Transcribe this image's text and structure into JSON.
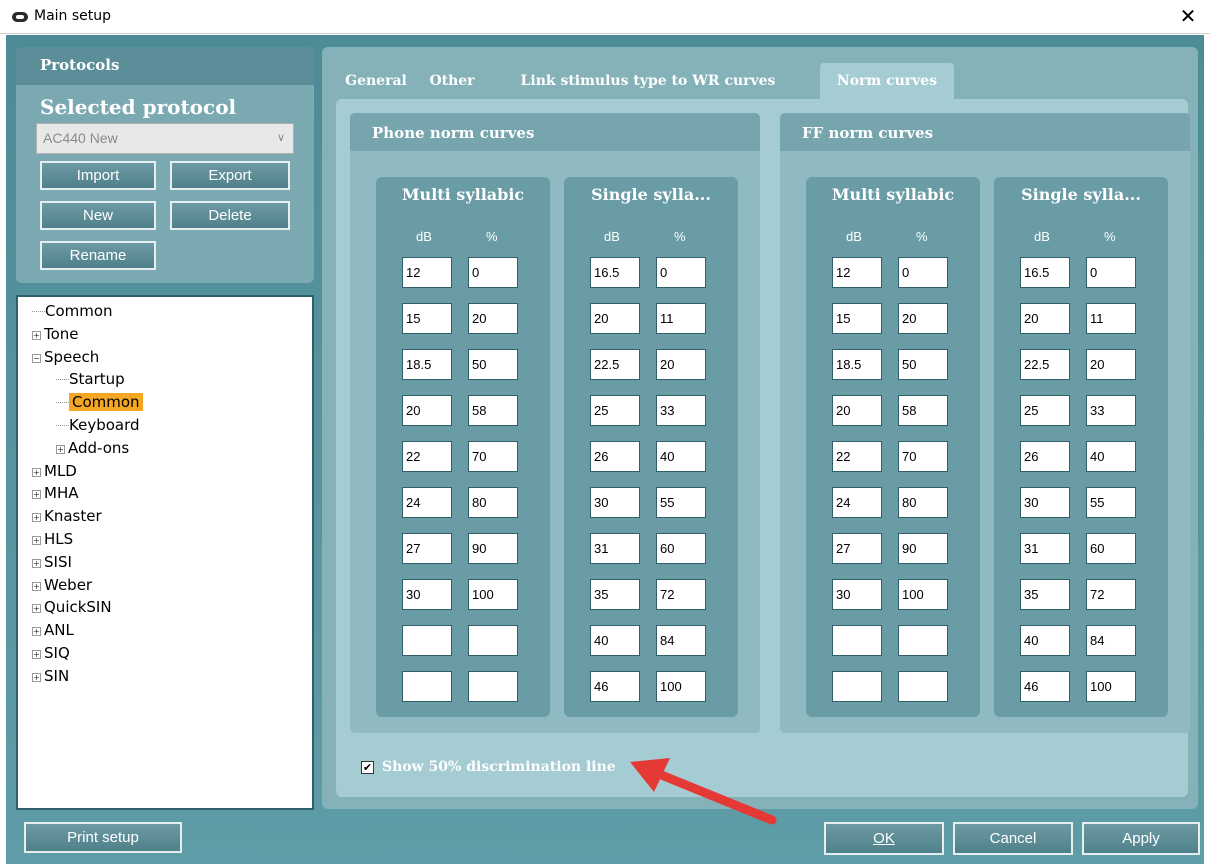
{
  "window": {
    "title": "Main setup"
  },
  "protocols": {
    "header": "Protocols",
    "selected_label": "Selected protocol",
    "selected_value": "AC440 New",
    "buttons": {
      "import": "Import",
      "export": "Export",
      "new": "New",
      "delete": "Delete",
      "rename": "Rename"
    }
  },
  "tree": {
    "items": [
      {
        "label": "Common",
        "expander": ""
      },
      {
        "label": "Tone",
        "expander": "+"
      },
      {
        "label": "Speech",
        "expander": "−"
      },
      {
        "label": "Startup",
        "expander": ""
      },
      {
        "label": "Common",
        "expander": "",
        "selected": true
      },
      {
        "label": "Keyboard",
        "expander": ""
      },
      {
        "label": "Add-ons",
        "expander": "+"
      },
      {
        "label": "MLD",
        "expander": "+"
      },
      {
        "label": "MHA",
        "expander": "+"
      },
      {
        "label": "Knaster",
        "expander": "+"
      },
      {
        "label": "HLS",
        "expander": "+"
      },
      {
        "label": "SISI",
        "expander": "+"
      },
      {
        "label": "Weber",
        "expander": "+"
      },
      {
        "label": "QuickSIN",
        "expander": "+"
      },
      {
        "label": "ANL",
        "expander": "+"
      },
      {
        "label": "SIQ",
        "expander": "+"
      },
      {
        "label": "SIN",
        "expander": "+"
      }
    ]
  },
  "print_button": "Print setup",
  "tabs": [
    "General",
    "Other",
    "Link stimulus type to WR curves",
    "Norm curves"
  ],
  "active_tab": "Norm curves",
  "groups": [
    {
      "title": "Phone norm curves",
      "subs": [
        {
          "title": "Multi syllabic",
          "col_db": "dB",
          "col_pct": "%",
          "rows": [
            [
              "12",
              "0"
            ],
            [
              "15",
              "20"
            ],
            [
              "18.5",
              "50"
            ],
            [
              "20",
              "58"
            ],
            [
              "22",
              "70"
            ],
            [
              "24",
              "80"
            ],
            [
              "27",
              "90"
            ],
            [
              "30",
              "100"
            ],
            [
              "",
              ""
            ],
            [
              "",
              ""
            ]
          ]
        },
        {
          "title": "Single sylla...",
          "col_db": "dB",
          "col_pct": "%",
          "rows": [
            [
              "16.5",
              "0"
            ],
            [
              "20",
              "11"
            ],
            [
              "22.5",
              "20"
            ],
            [
              "25",
              "33"
            ],
            [
              "26",
              "40"
            ],
            [
              "30",
              "55"
            ],
            [
              "31",
              "60"
            ],
            [
              "35",
              "72"
            ],
            [
              "40",
              "84"
            ],
            [
              "46",
              "100"
            ]
          ]
        }
      ]
    },
    {
      "title": "FF norm curves",
      "subs": [
        {
          "title": "Multi syllabic",
          "col_db": "dB",
          "col_pct": "%",
          "rows": [
            [
              "12",
              "0"
            ],
            [
              "15",
              "20"
            ],
            [
              "18.5",
              "50"
            ],
            [
              "20",
              "58"
            ],
            [
              "22",
              "70"
            ],
            [
              "24",
              "80"
            ],
            [
              "27",
              "90"
            ],
            [
              "30",
              "100"
            ],
            [
              "",
              ""
            ],
            [
              "",
              ""
            ]
          ]
        },
        {
          "title": "Single sylla...",
          "col_db": "dB",
          "col_pct": "%",
          "rows": [
            [
              "16.5",
              "0"
            ],
            [
              "20",
              "11"
            ],
            [
              "22.5",
              "20"
            ],
            [
              "25",
              "33"
            ],
            [
              "26",
              "40"
            ],
            [
              "30",
              "55"
            ],
            [
              "31",
              "60"
            ],
            [
              "35",
              "72"
            ],
            [
              "40",
              "84"
            ],
            [
              "46",
              "100"
            ]
          ]
        }
      ]
    }
  ],
  "checkbox": {
    "label": "Show 50% discrimination line",
    "checked": true,
    "mark": "✔"
  },
  "bottom_buttons": {
    "ok": "OK",
    "cancel": "Cancel",
    "apply": "Apply"
  },
  "close_glyph": "✕",
  "colors": {
    "accent": "#5e9da7",
    "highlight": "#f5a623",
    "annotation_arrow": "#e53935"
  }
}
